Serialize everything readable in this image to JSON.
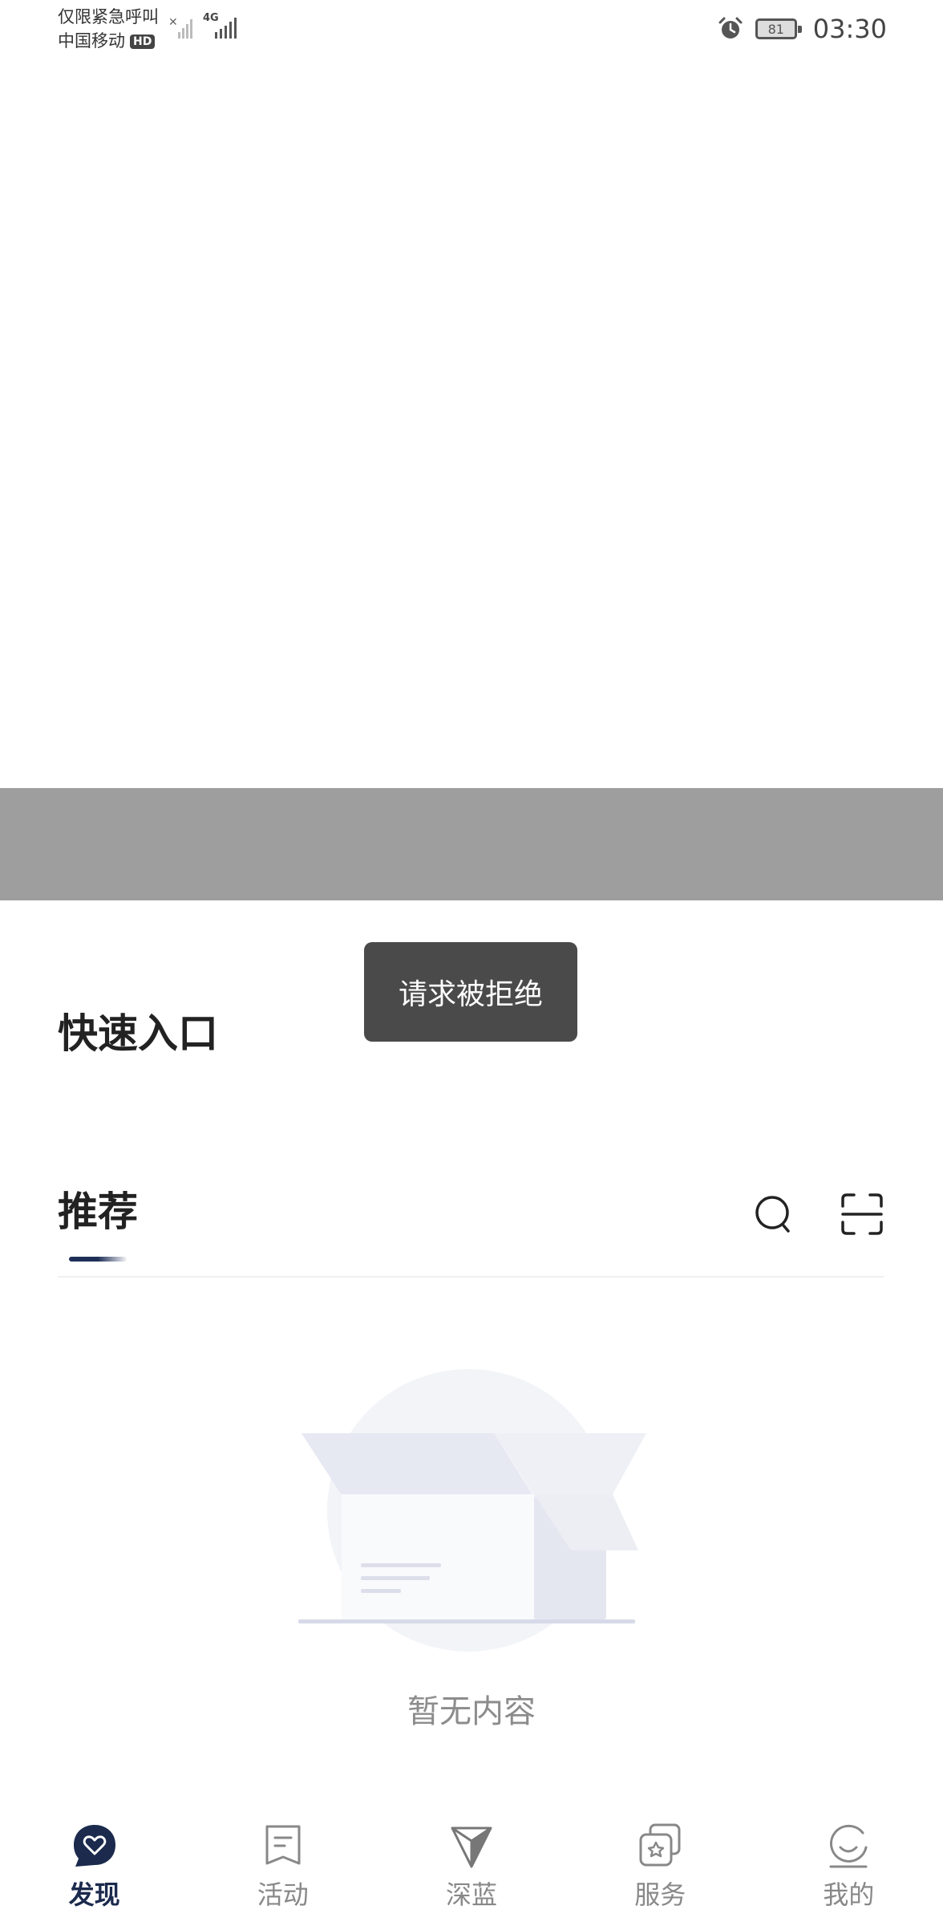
{
  "status_bar": {
    "emergency_text": "仅限紧急呼叫",
    "carrier": "中国移动",
    "hd_badge": "HD",
    "network_badge": "4G",
    "battery": "81",
    "time": "03:30"
  },
  "toast": {
    "message": "请求被拒绝"
  },
  "sections": {
    "quick_entry_title": "快速入口",
    "recommend_title": "推荐"
  },
  "empty_state": {
    "text": "暂无内容"
  },
  "tabbar": {
    "items": [
      {
        "label": "发现",
        "icon": "discover-heart-icon",
        "active": true
      },
      {
        "label": "活动",
        "icon": "activity-icon",
        "active": false
      },
      {
        "label": "深蓝",
        "icon": "shenlan-logo-icon",
        "active": false
      },
      {
        "label": "服务",
        "icon": "service-icon",
        "active": false
      },
      {
        "label": "我的",
        "icon": "profile-icon",
        "active": false
      }
    ]
  },
  "colors": {
    "brand_navy": "#1b2a4d",
    "toast_bg": "#4a4a4a",
    "band_gray": "#9e9e9e"
  }
}
